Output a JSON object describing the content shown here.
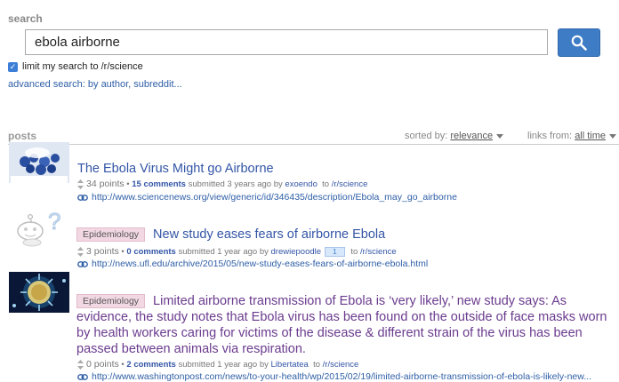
{
  "search": {
    "label": "search",
    "query": "ebola airborne",
    "limit_label": "limit my search to /r/science",
    "limit_checked": true,
    "advanced_link": "advanced search: by author, subreddit..."
  },
  "posts_section": {
    "label": "posts",
    "sorted_label": "sorted by:",
    "sorted_value": "relevance",
    "links_from_label": "links from:",
    "links_from_value": "all time"
  },
  "results": [
    {
      "thumbnail": "science-news-thumbnail",
      "title": "The Ebola Virus Might go Airborne",
      "flair": "",
      "points": "34 points",
      "comments": "15 comments",
      "submitted": "submitted 3 years ago by",
      "author": "exoendo",
      "to": "to",
      "subreddit": "/r/science",
      "url": "http://www.sciencenews.org/view/generic/id/346435/description/Ebola_may_go_airborne"
    },
    {
      "thumbnail": "reddit-alien-thumbnail",
      "title": "New study eases fears of airborne Ebola",
      "flair": "Epidemiology",
      "points": "3 points",
      "comments": "0 comments",
      "submitted": "submitted 1 year ago by",
      "author": "drewiepoodle",
      "badge": "1",
      "to": "to",
      "subreddit": "/r/science",
      "url": "http://news.ufl.edu/archive/2015/05/new-study-eases-fears-of-airborne-ebola.html"
    },
    {
      "thumbnail": "ebola-virus-thumbnail",
      "flair": "Epidemiology",
      "title_lines": [
        "Limited airborne transmission of Ebola is ‘very likely,’ new study says: As",
        "evidence, the study notes that Ebola virus has been found on the outside of face masks worn",
        "by health workers caring for victims of the disease & different strain of the virus has been",
        "passed between animals via respiration."
      ],
      "points": "0 points",
      "comments": "2 comments",
      "submitted": "submitted 1 year ago by",
      "author": "Libertatea",
      "to": "to",
      "subreddit": "/r/science",
      "url": "http://www.washingtonpost.com/news/to-your-health/wp/2015/02/19/limited-airborne-transmission-of-ebola-is-likely-new..."
    }
  ],
  "colors": {
    "link_blue": "#3355a6",
    "visited_purple": "#6a3b8e",
    "search_button": "#3f7cc6",
    "flair_bg": "#f2d8e2"
  }
}
